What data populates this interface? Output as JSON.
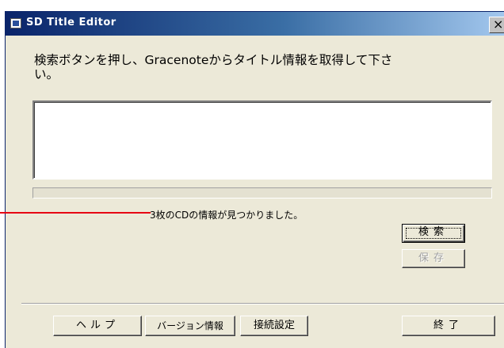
{
  "window": {
    "title": "SD Title Editor",
    "close_label": "×"
  },
  "instruction": "検索ボタンを押し、Gracenoteからタイトル情報を取得して下さい。",
  "progress": {
    "value": 0
  },
  "status": "3枚のCDの情報が見つかりました。",
  "buttons": {
    "search": "検索",
    "save": "保存",
    "help": "ヘルプ",
    "version": "バージョン情報",
    "connect": "接続設定",
    "exit": "終了"
  },
  "colors": {
    "annotation": "#e60012",
    "titlebar": "#0a246a",
    "dialog_face": "#ece9d8"
  }
}
